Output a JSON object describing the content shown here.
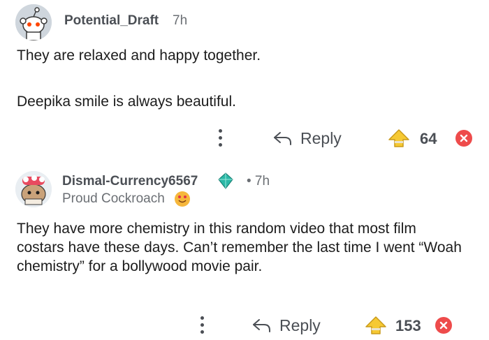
{
  "comments": [
    {
      "username": "Potential_Draft",
      "time": "7h",
      "paragraphs": [
        "They are relaxed and happy together.",
        "Deepika smile is always beautiful."
      ],
      "reply_label": "Reply",
      "score": "64"
    },
    {
      "username": "Dismal-Currency6567",
      "time": "• 7h",
      "flair": "Proud Cockroach",
      "body": "They have more chemistry in this random video that most film costars have these days. Can’t remember the last time I went “Woah chemistry” for a bollywood movie pair.",
      "reply_label": "Reply",
      "score": "153"
    }
  ],
  "icons": {
    "more": "more-vertical-icon",
    "reply": "reply-arrow-icon",
    "upvote": "upvote-icon",
    "downvote": "downvote-icon"
  },
  "colors": {
    "upvote": "#f6c933",
    "downvote": "#ee4b4b",
    "text": "#1c1c1c",
    "muted": "#4b4f55"
  }
}
